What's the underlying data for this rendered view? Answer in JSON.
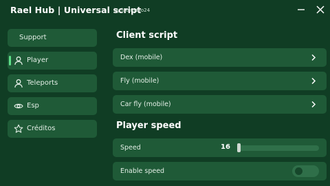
{
  "window": {
    "title": "Rael Hub | Universal script",
    "subtitle": "by laelmano24"
  },
  "sidebar": {
    "items": [
      {
        "label": "Support",
        "icon": null,
        "active": false
      },
      {
        "label": "Player",
        "icon": "user-icon",
        "active": true
      },
      {
        "label": "Teleports",
        "icon": "user-icon",
        "active": false
      },
      {
        "label": "Esp",
        "icon": "eye-icon",
        "active": false
      },
      {
        "label": "Créditos",
        "icon": "star-icon",
        "active": false
      }
    ]
  },
  "main": {
    "client_script": {
      "title": "Client script",
      "items": [
        {
          "label": "Dex (mobile)",
          "icon": "chevron-right-icon"
        },
        {
          "label": "Fly (mobile)",
          "icon": "chevron-right-icon"
        },
        {
          "label": "Car fly (mobile)",
          "icon": "chevron-right-icon"
        }
      ]
    },
    "player_speed": {
      "title": "Player speed",
      "speed": {
        "label": "Speed",
        "value": "16",
        "fraction": 0.0
      },
      "enable_speed": {
        "label": "Enable speed",
        "enabled": false
      }
    }
  },
  "colors": {
    "background": "#103d24",
    "panel": "#1f5a37",
    "accent": "#5fe08a",
    "text": "#eaf3ec"
  }
}
